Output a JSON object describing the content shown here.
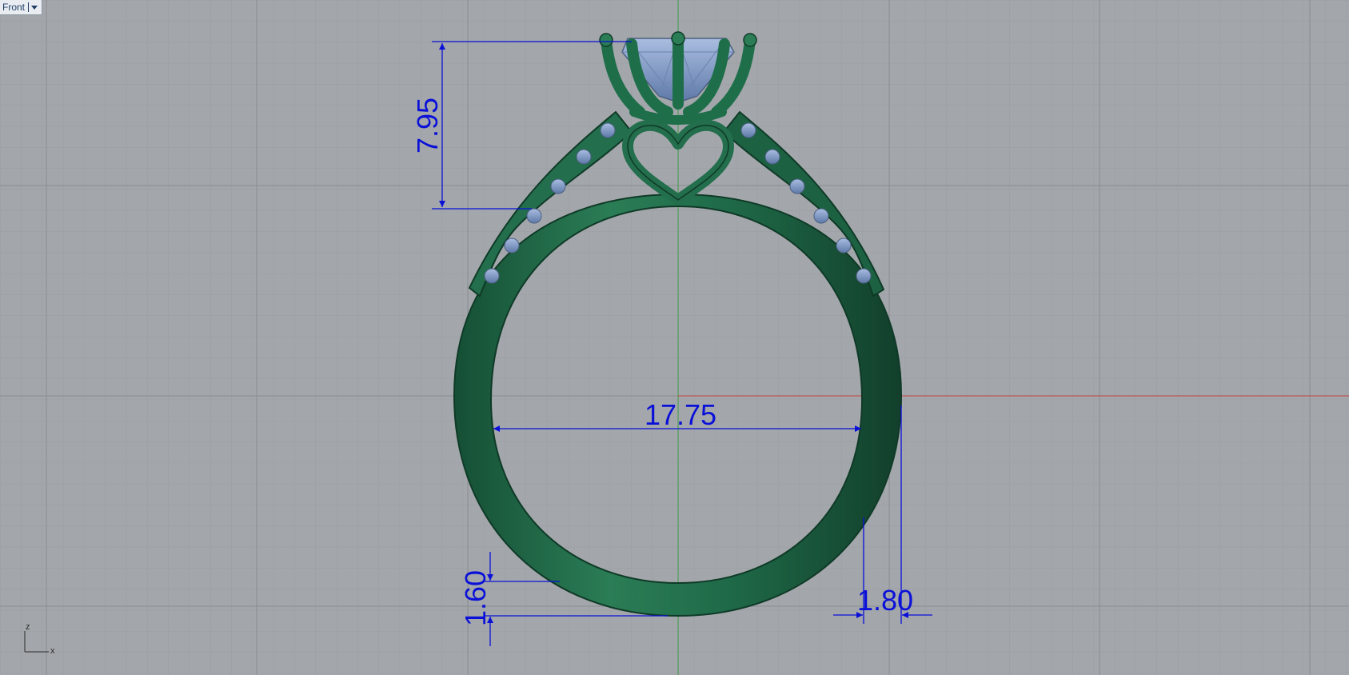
{
  "viewport": {
    "name": "Front",
    "background_color": "#a3a7ab",
    "grid_color_minor": "#9a9ea3",
    "grid_color_major": "#8a8e93",
    "x_axis_color": "#c0453c",
    "z_axis_color": "#3c9a46"
  },
  "model": {
    "metal_color": "#1f6e4a",
    "gem_color": "#7d98c6"
  },
  "dimensions": {
    "color": "#0a10d8",
    "head_height": "7.95",
    "inner_diameter": "17.75",
    "bottom_thickness": "1.60",
    "band_width": "1.80"
  },
  "axis_widget": {
    "vertical_label": "z",
    "horizontal_label": "x"
  }
}
